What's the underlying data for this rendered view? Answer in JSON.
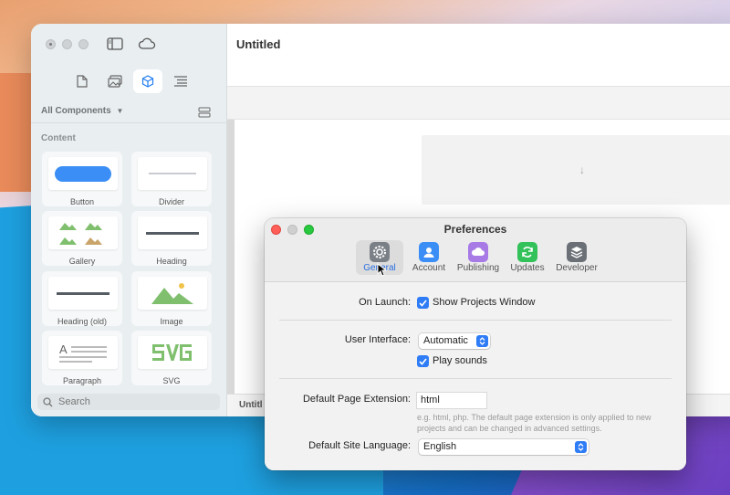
{
  "main_window": {
    "title": "Untitled",
    "bottom_tab": "Untitl",
    "sidebar": {
      "filter_label": "All Components",
      "section_label": "Content",
      "components": [
        {
          "label": "Button"
        },
        {
          "label": "Divider"
        },
        {
          "label": "Gallery"
        },
        {
          "label": "Heading"
        },
        {
          "label": "Heading (old)"
        },
        {
          "label": "Image"
        },
        {
          "label": "Paragraph"
        },
        {
          "label": "SVG"
        }
      ],
      "search_placeholder": "Search"
    }
  },
  "preferences": {
    "title": "Preferences",
    "tabs": [
      {
        "label": "General",
        "icon": "gear-icon"
      },
      {
        "label": "Account",
        "icon": "person-icon"
      },
      {
        "label": "Publishing",
        "icon": "cloud-icon"
      },
      {
        "label": "Updates",
        "icon": "refresh-icon"
      },
      {
        "label": "Developer",
        "icon": "layers-icon"
      }
    ],
    "on_launch_label": "On Launch:",
    "show_projects_label": "Show Projects Window",
    "user_interface_label": "User Interface:",
    "user_interface_value": "Automatic",
    "play_sounds_label": "Play sounds",
    "default_page_ext_label": "Default Page Extension:",
    "default_page_ext_value": "html",
    "default_page_ext_hint": "e.g. html, php. The default page extension is only applied to new projects and can be changed in advanced settings.",
    "default_site_lang_label": "Default Site Language:",
    "default_site_lang_value": "English"
  },
  "colors": {
    "accent": "#2e7cf6",
    "close": "#ff5f57",
    "zoom": "#28c840"
  }
}
